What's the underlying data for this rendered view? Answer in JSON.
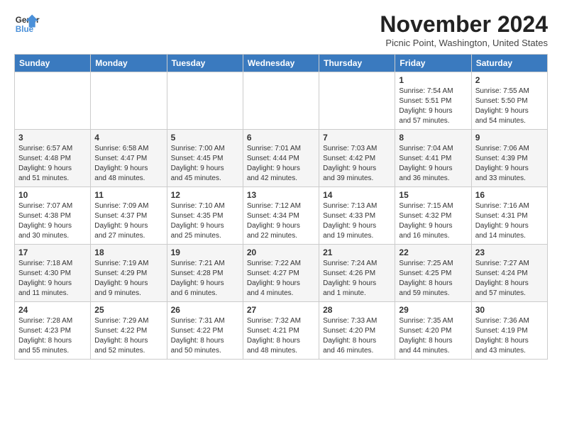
{
  "logo": {
    "line1": "General",
    "line2": "Blue"
  },
  "title": "November 2024",
  "location": "Picnic Point, Washington, United States",
  "headers": [
    "Sunday",
    "Monday",
    "Tuesday",
    "Wednesday",
    "Thursday",
    "Friday",
    "Saturday"
  ],
  "weeks": [
    [
      {
        "day": "",
        "detail": ""
      },
      {
        "day": "",
        "detail": ""
      },
      {
        "day": "",
        "detail": ""
      },
      {
        "day": "",
        "detail": ""
      },
      {
        "day": "",
        "detail": ""
      },
      {
        "day": "1",
        "detail": "Sunrise: 7:54 AM\nSunset: 5:51 PM\nDaylight: 9 hours\nand 57 minutes."
      },
      {
        "day": "2",
        "detail": "Sunrise: 7:55 AM\nSunset: 5:50 PM\nDaylight: 9 hours\nand 54 minutes."
      }
    ],
    [
      {
        "day": "3",
        "detail": "Sunrise: 6:57 AM\nSunset: 4:48 PM\nDaylight: 9 hours\nand 51 minutes."
      },
      {
        "day": "4",
        "detail": "Sunrise: 6:58 AM\nSunset: 4:47 PM\nDaylight: 9 hours\nand 48 minutes."
      },
      {
        "day": "5",
        "detail": "Sunrise: 7:00 AM\nSunset: 4:45 PM\nDaylight: 9 hours\nand 45 minutes."
      },
      {
        "day": "6",
        "detail": "Sunrise: 7:01 AM\nSunset: 4:44 PM\nDaylight: 9 hours\nand 42 minutes."
      },
      {
        "day": "7",
        "detail": "Sunrise: 7:03 AM\nSunset: 4:42 PM\nDaylight: 9 hours\nand 39 minutes."
      },
      {
        "day": "8",
        "detail": "Sunrise: 7:04 AM\nSunset: 4:41 PM\nDaylight: 9 hours\nand 36 minutes."
      },
      {
        "day": "9",
        "detail": "Sunrise: 7:06 AM\nSunset: 4:39 PM\nDaylight: 9 hours\nand 33 minutes."
      }
    ],
    [
      {
        "day": "10",
        "detail": "Sunrise: 7:07 AM\nSunset: 4:38 PM\nDaylight: 9 hours\nand 30 minutes."
      },
      {
        "day": "11",
        "detail": "Sunrise: 7:09 AM\nSunset: 4:37 PM\nDaylight: 9 hours\nand 27 minutes."
      },
      {
        "day": "12",
        "detail": "Sunrise: 7:10 AM\nSunset: 4:35 PM\nDaylight: 9 hours\nand 25 minutes."
      },
      {
        "day": "13",
        "detail": "Sunrise: 7:12 AM\nSunset: 4:34 PM\nDaylight: 9 hours\nand 22 minutes."
      },
      {
        "day": "14",
        "detail": "Sunrise: 7:13 AM\nSunset: 4:33 PM\nDaylight: 9 hours\nand 19 minutes."
      },
      {
        "day": "15",
        "detail": "Sunrise: 7:15 AM\nSunset: 4:32 PM\nDaylight: 9 hours\nand 16 minutes."
      },
      {
        "day": "16",
        "detail": "Sunrise: 7:16 AM\nSunset: 4:31 PM\nDaylight: 9 hours\nand 14 minutes."
      }
    ],
    [
      {
        "day": "17",
        "detail": "Sunrise: 7:18 AM\nSunset: 4:30 PM\nDaylight: 9 hours\nand 11 minutes."
      },
      {
        "day": "18",
        "detail": "Sunrise: 7:19 AM\nSunset: 4:29 PM\nDaylight: 9 hours\nand 9 minutes."
      },
      {
        "day": "19",
        "detail": "Sunrise: 7:21 AM\nSunset: 4:28 PM\nDaylight: 9 hours\nand 6 minutes."
      },
      {
        "day": "20",
        "detail": "Sunrise: 7:22 AM\nSunset: 4:27 PM\nDaylight: 9 hours\nand 4 minutes."
      },
      {
        "day": "21",
        "detail": "Sunrise: 7:24 AM\nSunset: 4:26 PM\nDaylight: 9 hours\nand 1 minute."
      },
      {
        "day": "22",
        "detail": "Sunrise: 7:25 AM\nSunset: 4:25 PM\nDaylight: 8 hours\nand 59 minutes."
      },
      {
        "day": "23",
        "detail": "Sunrise: 7:27 AM\nSunset: 4:24 PM\nDaylight: 8 hours\nand 57 minutes."
      }
    ],
    [
      {
        "day": "24",
        "detail": "Sunrise: 7:28 AM\nSunset: 4:23 PM\nDaylight: 8 hours\nand 55 minutes."
      },
      {
        "day": "25",
        "detail": "Sunrise: 7:29 AM\nSunset: 4:22 PM\nDaylight: 8 hours\nand 52 minutes."
      },
      {
        "day": "26",
        "detail": "Sunrise: 7:31 AM\nSunset: 4:22 PM\nDaylight: 8 hours\nand 50 minutes."
      },
      {
        "day": "27",
        "detail": "Sunrise: 7:32 AM\nSunset: 4:21 PM\nDaylight: 8 hours\nand 48 minutes."
      },
      {
        "day": "28",
        "detail": "Sunrise: 7:33 AM\nSunset: 4:20 PM\nDaylight: 8 hours\nand 46 minutes."
      },
      {
        "day": "29",
        "detail": "Sunrise: 7:35 AM\nSunset: 4:20 PM\nDaylight: 8 hours\nand 44 minutes."
      },
      {
        "day": "30",
        "detail": "Sunrise: 7:36 AM\nSunset: 4:19 PM\nDaylight: 8 hours\nand 43 minutes."
      }
    ]
  ]
}
